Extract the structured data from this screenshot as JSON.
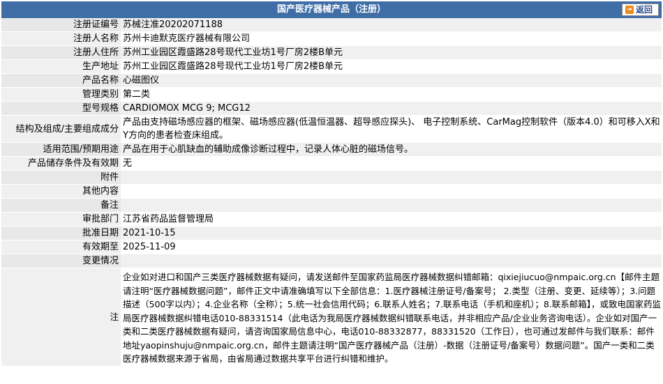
{
  "header": {
    "title": "国产医疗器械产品（注册）",
    "back_label": "返回"
  },
  "rows": [
    {
      "label": "注册证编号",
      "value": "苏械注准20202071188"
    },
    {
      "label": "注册人名称",
      "value": "苏州卡迪默克医疗器械有限公司"
    },
    {
      "label": "注册人住所",
      "value": "苏州工业园区霞盛路28号现代工业坊1号厂房2楼B单元"
    },
    {
      "label": "生产地址",
      "value": "苏州工业园区霞盛路28号现代工业坊1号厂房2楼B单元"
    },
    {
      "label": "产品名称",
      "value": "心磁图仪"
    },
    {
      "label": "管理类别",
      "value": "第二类"
    },
    {
      "label": "型号规格",
      "value": "CARDIOMOX MCG 9; MCG12"
    },
    {
      "label": "结构及组成/主要组成成分",
      "value": "产品由支持磁场感应器的框架、磁场感应器(低温恒温器、超导感应探头)、 电子控制系统、CarMag控制软件（版本4.0）和可移入X和Y方向的患者检查床组成。"
    },
    {
      "label": "适用范围/预期用途",
      "value": "产品在用于心肌缺血的辅助成像诊断过程中，记录人体心脏的磁场信号。"
    },
    {
      "label": "产品储存条件及有效期",
      "value": "无"
    },
    {
      "label": "附件",
      "value": ""
    },
    {
      "label": "其他内容",
      "value": ""
    },
    {
      "label": "备注",
      "value": ""
    },
    {
      "label": "审批部门",
      "value": "江苏省药品监督管理局"
    },
    {
      "label": "批准日期",
      "value": "2021-10-15"
    },
    {
      "label": "有效期至",
      "value": "2025-11-09"
    },
    {
      "label": "变更情况",
      "value": ""
    }
  ],
  "note": {
    "label": "注",
    "text": "企业如对进口和国产三类医疗器械数据有疑问，请发送邮件至国家药监局医疗器械数据纠错邮箱：qixiejiucuo@nmpaic.org.cn【邮件主题请注明“医疗器械数据问题”，邮件正文中请准确填写以下全部信息：1.医疗器械注册证号/备案号； 2.类型（注册、变更、延续等）；3.问题描述（500字以内）；4.企业名称（全称）；5.统一社会信用代码；6.联系人姓名；7.联系电话（手机和座机）；8.联系邮箱】，或致电国家药监局医疗器械数据纠错电话010-88331514（此电话为我局医疗器械数据纠错联系电话，并非相应产品/企业业务咨询电话）。企业如对国产一类和二类医疗器械数据有疑问，请咨询国家局信息中心，电话010-88332877，88331520（工作日），也可通过发邮件与我们联系：邮件地址yaopinshuju@nmpaic.org.cn，邮件主题请注明“国产医疗器械产品（注册）-数据（注册证号/备案号）数据问题”。国产一类和二类医疗器械数据来源于省局，由省局通过数据共享平台进行纠错和维护。"
  }
}
